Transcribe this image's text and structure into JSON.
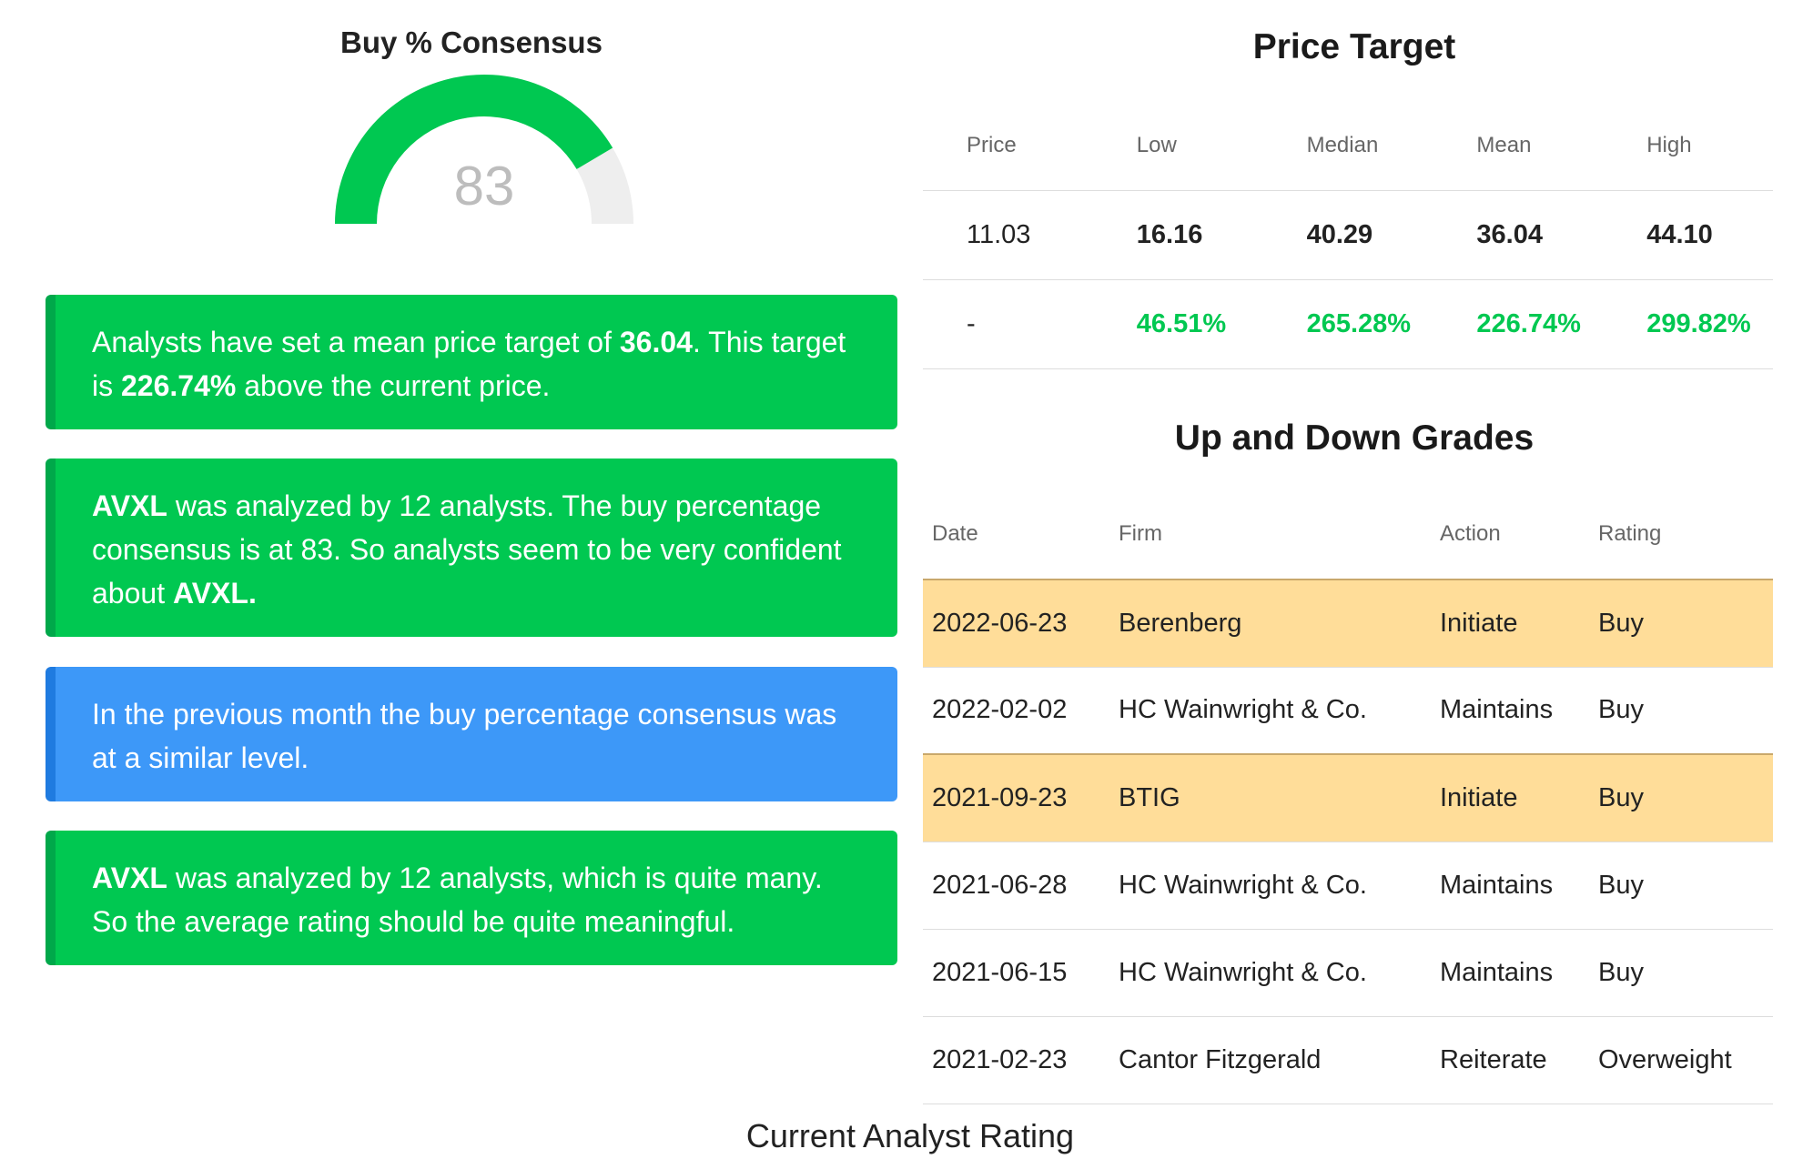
{
  "consensus": {
    "title": "Buy % Consensus",
    "value": "83",
    "percent": 83,
    "colors": {
      "fill": "#00c851",
      "track": "#eeeeee"
    }
  },
  "cards": [
    {
      "color": "#00c851",
      "parts": [
        {
          "text": "Analysts have set a mean price target of ",
          "bold": false
        },
        {
          "text": "36.04",
          "bold": true
        },
        {
          "text": ". This target is ",
          "bold": false
        },
        {
          "text": "226.74%",
          "bold": true
        },
        {
          "text": " above the current price.",
          "bold": false
        }
      ]
    },
    {
      "color": "#00c851",
      "parts": [
        {
          "text": "AVXL",
          "bold": true
        },
        {
          "text": " was analyzed by 12 analysts. The buy percentage consensus is at 83. So analysts seem to be very confident about ",
          "bold": false
        },
        {
          "text": "AVXL.",
          "bold": true
        }
      ]
    },
    {
      "color": "#3d98f8",
      "parts": [
        {
          "text": "In the previous month the buy percentage consensus was at a similar level.",
          "bold": false
        }
      ]
    },
    {
      "color": "#00c851",
      "parts": [
        {
          "text": "AVXL",
          "bold": true
        },
        {
          "text": " was analyzed by 12 analysts, which is quite many. So the average rating should be quite meaningful.",
          "bold": false
        }
      ]
    }
  ],
  "price_target": {
    "title": "Price Target",
    "headers": [
      "Price",
      "Low",
      "Median",
      "Mean",
      "High"
    ],
    "values": [
      "11.03",
      "16.16",
      "40.29",
      "36.04",
      "44.10"
    ],
    "percents": [
      "-",
      "46.51%",
      "265.28%",
      "226.74%",
      "299.82%"
    ]
  },
  "grades": {
    "title": "Up and Down Grades",
    "headers": [
      "Date",
      "Firm",
      "Action",
      "Rating"
    ],
    "rows": [
      {
        "date": "2022-06-23",
        "firm": "Berenberg",
        "action": "Initiate",
        "rating": "Buy",
        "highlight": true
      },
      {
        "date": "2022-02-02",
        "firm": "HC Wainwright & Co.",
        "action": "Maintains",
        "rating": "Buy",
        "highlight": false
      },
      {
        "date": "2021-09-23",
        "firm": "BTIG",
        "action": "Initiate",
        "rating": "Buy",
        "highlight": true
      },
      {
        "date": "2021-06-28",
        "firm": "HC Wainwright & Co.",
        "action": "Maintains",
        "rating": "Buy",
        "highlight": false
      },
      {
        "date": "2021-06-15",
        "firm": "HC Wainwright & Co.",
        "action": "Maintains",
        "rating": "Buy",
        "highlight": false
      },
      {
        "date": "2021-02-23",
        "firm": "Cantor Fitzgerald",
        "action": "Reiterate",
        "rating": "Overweight",
        "highlight": false
      }
    ],
    "highlight_color": "#ffdd99"
  },
  "footer": {
    "caption": "Current Analyst Rating"
  }
}
